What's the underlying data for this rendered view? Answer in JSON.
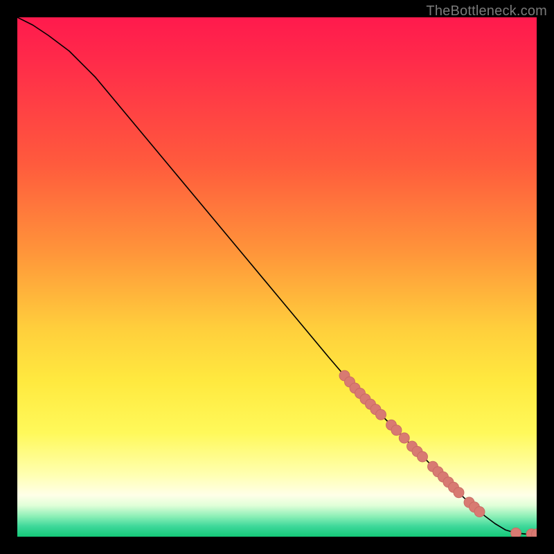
{
  "watermark": "TheBottleneck.com",
  "colors": {
    "curve_stroke": "#000000",
    "marker_fill": "#d87a72",
    "marker_stroke": "#c86a63",
    "gradient_stops": [
      "#ff1a4d",
      "#ff5a3d",
      "#ff943a",
      "#ffcf3c",
      "#ffe93f",
      "#fff95a",
      "#ffffb0",
      "#ffffe8",
      "#e0ffd8",
      "#90f0b8",
      "#3ed89a",
      "#14c878"
    ]
  },
  "chart_data": {
    "type": "line",
    "title": "",
    "xlabel": "",
    "ylabel": "",
    "xlim": [
      0,
      100
    ],
    "ylim": [
      0,
      100
    ],
    "grid": false,
    "legend": false,
    "series": [
      {
        "name": "bottleneck-curve",
        "x": [
          0,
          3,
          6,
          10,
          15,
          20,
          25,
          30,
          35,
          40,
          45,
          50,
          55,
          60,
          63,
          65,
          68,
          70,
          72,
          74,
          76,
          78,
          80,
          82,
          84,
          86,
          88,
          90,
          92,
          94,
          96,
          98,
          100
        ],
        "y": [
          100,
          98.5,
          96.5,
          93.5,
          88.5,
          82.5,
          76.5,
          70.5,
          64.5,
          58.5,
          52.5,
          46.5,
          40.5,
          34.5,
          31,
          28.5,
          25.5,
          23.5,
          21.5,
          19.5,
          17.5,
          15.5,
          13.5,
          11.5,
          9.5,
          7.5,
          5.7,
          4.0,
          2.5,
          1.3,
          0.7,
          0.5,
          0.5
        ]
      }
    ],
    "markers": [
      {
        "x": 63.0,
        "y": 31.0
      },
      {
        "x": 64.0,
        "y": 29.8
      },
      {
        "x": 65.0,
        "y": 28.6
      },
      {
        "x": 66.0,
        "y": 27.6
      },
      {
        "x": 67.0,
        "y": 26.5
      },
      {
        "x": 68.0,
        "y": 25.5
      },
      {
        "x": 69.0,
        "y": 24.5
      },
      {
        "x": 70.0,
        "y": 23.5
      },
      {
        "x": 72.0,
        "y": 21.5
      },
      {
        "x": 73.0,
        "y": 20.5
      },
      {
        "x": 74.5,
        "y": 19.0
      },
      {
        "x": 76.0,
        "y": 17.4
      },
      {
        "x": 77.0,
        "y": 16.4
      },
      {
        "x": 78.0,
        "y": 15.4
      },
      {
        "x": 80.0,
        "y": 13.5
      },
      {
        "x": 81.0,
        "y": 12.5
      },
      {
        "x": 82.0,
        "y": 11.5
      },
      {
        "x": 83.0,
        "y": 10.5
      },
      {
        "x": 84.0,
        "y": 9.5
      },
      {
        "x": 85.0,
        "y": 8.5
      },
      {
        "x": 87.0,
        "y": 6.6
      },
      {
        "x": 88.0,
        "y": 5.7
      },
      {
        "x": 89.0,
        "y": 4.8
      },
      {
        "x": 96.0,
        "y": 0.7
      },
      {
        "x": 99.0,
        "y": 0.5
      },
      {
        "x": 100.0,
        "y": 0.5
      }
    ]
  }
}
